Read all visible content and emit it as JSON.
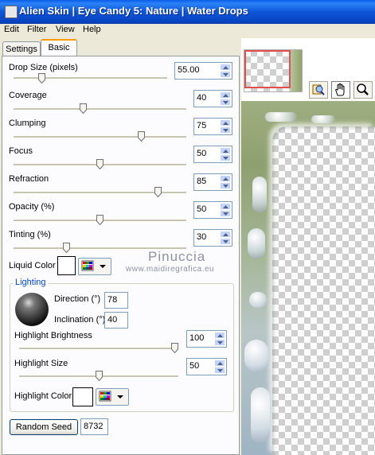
{
  "window": {
    "title": "Alien Skin | Eye Candy 5: Nature | Water Drops"
  },
  "menu": {
    "items": [
      "Edit",
      "Filter",
      "View",
      "Help"
    ]
  },
  "tabs": [
    {
      "label": "Settings",
      "active": false
    },
    {
      "label": "Basic",
      "active": true
    }
  ],
  "controls": {
    "drop_size": {
      "label": "Drop Size (pixels)",
      "value": "55.00",
      "slider_fraction": 0.17
    },
    "coverage": {
      "label": "Coverage",
      "value": "40",
      "slider_fraction": 0.4
    },
    "clumping": {
      "label": "Clumping",
      "value": "75",
      "slider_fraction": 0.75
    },
    "focus": {
      "label": "Focus",
      "value": "50",
      "slider_fraction": 0.5
    },
    "refraction": {
      "label": "Refraction",
      "value": "85",
      "slider_fraction": 0.85
    },
    "opacity": {
      "label": "Opacity (%)",
      "value": "50",
      "slider_fraction": 0.5
    },
    "tinting": {
      "label": "Tinting (%)",
      "value": "30",
      "slider_fraction": 0.3
    },
    "liquid_color": {
      "label": "Liquid Color",
      "color": "#ffffff"
    }
  },
  "lighting": {
    "group_label": "Lighting",
    "direction": {
      "label": "Direction (°)",
      "value": "78"
    },
    "inclination": {
      "label": "Inclination (°)",
      "value": "40"
    },
    "highlight_brightness": {
      "label": "Highlight Brightness",
      "value": "100",
      "slider_fraction": 1.0
    },
    "highlight_size": {
      "label": "Highlight Size",
      "value": "50",
      "slider_fraction": 0.5
    },
    "highlight_color": {
      "label": "Highlight Color",
      "color": "#ffffff"
    }
  },
  "random_seed": {
    "button_label": "Random Seed",
    "value": "8732"
  },
  "watermark": {
    "line1": "Pinuccia",
    "line2": "www.maidiregrafica.eu"
  },
  "toolbar": {
    "icons": [
      "zoom-preview-icon",
      "hand-icon",
      "magnifier-icon"
    ]
  },
  "colors": {
    "accent_tab": "#ff9a00",
    "nav_frame": "#e05050",
    "title_blue": "#0a55d8"
  }
}
